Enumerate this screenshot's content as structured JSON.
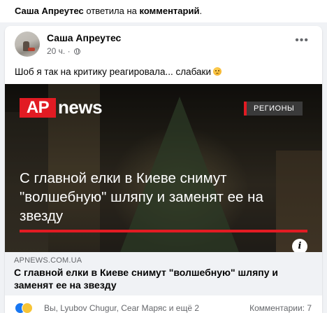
{
  "notification": {
    "actor": "Саша Апреутес",
    "action": "ответила на",
    "object": "комментарий",
    "end": "."
  },
  "post": {
    "author": "Саша Апреутес",
    "time": "20 ч.",
    "separator": "·",
    "more": "•••",
    "text": "Шоб я так на критику реагировала... слабаки"
  },
  "image": {
    "brand_ap": "AP",
    "brand_news": "news",
    "section": "РЕГИОНЫ",
    "headline": "С главной елки в Киеве снимут \"волшебную\" шляпу и заменят ее на звезду",
    "info": "i"
  },
  "link": {
    "domain": "APNEWS.COM.UA",
    "title": "С главной елки в Киеве снимут \"волшебную\" шляпу и заменят ее на звезду"
  },
  "footer": {
    "reactors": "Вы, Lyubov Chugur, Сear Маряс и ещё 2",
    "comments": "Комментарии: 7"
  },
  "colors": {
    "accent": "#1877f2",
    "ap_red": "#e21b23"
  }
}
